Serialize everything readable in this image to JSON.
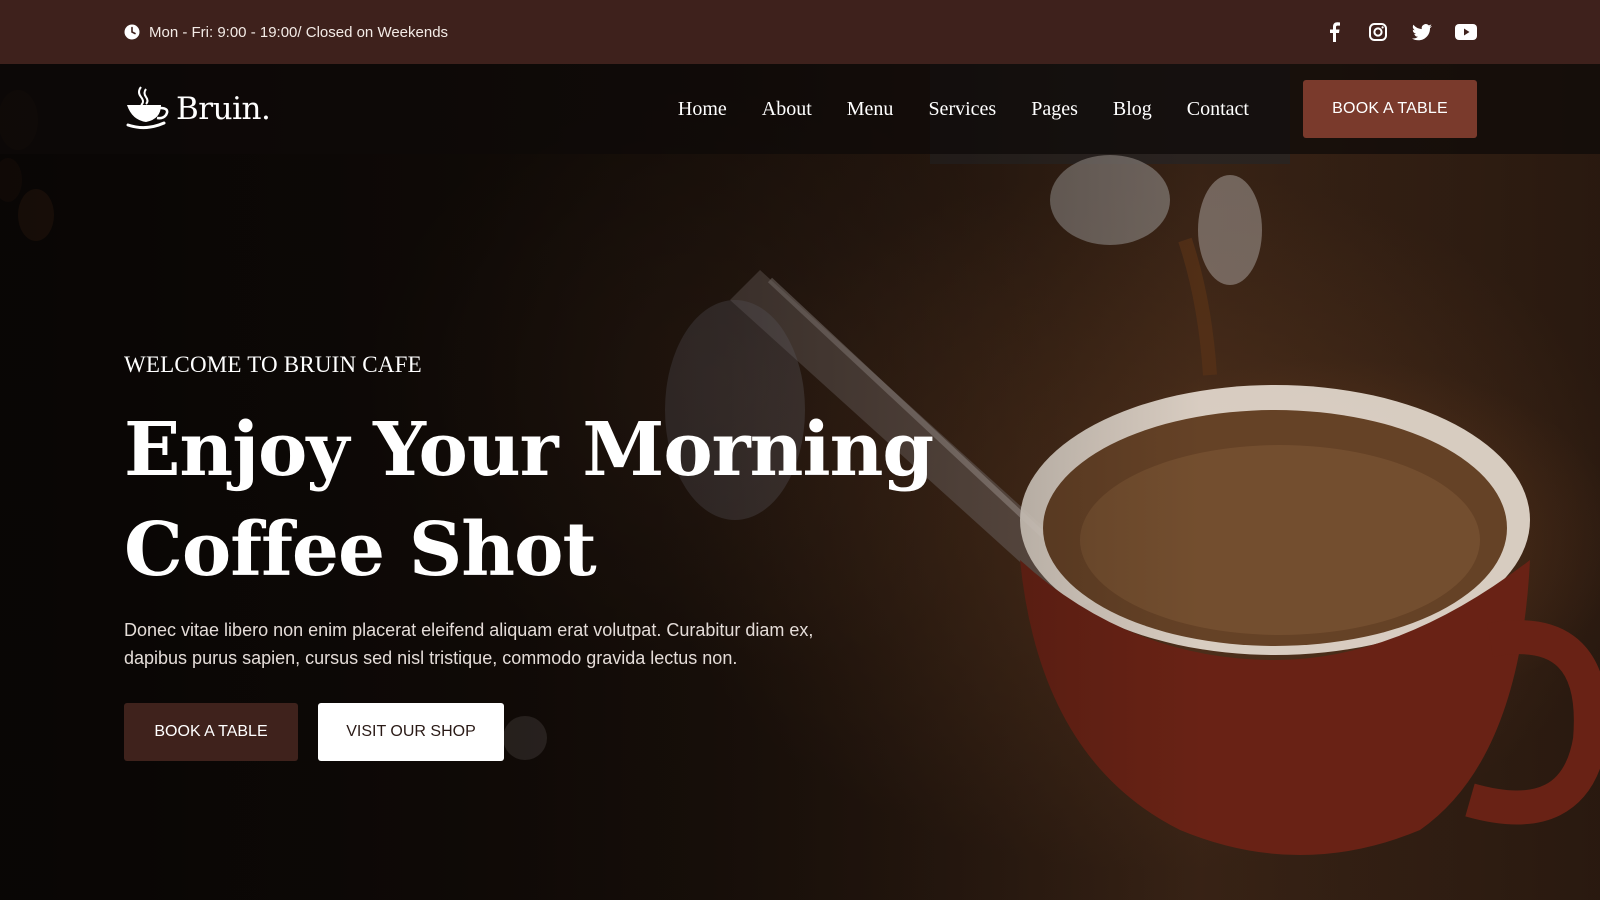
{
  "topbar": {
    "hours": "Mon - Fri: 9:00 - 19:00/ Closed on Weekends",
    "hours_icon": "clock-icon",
    "social": [
      {
        "name": "facebook-icon"
      },
      {
        "name": "instagram-icon"
      },
      {
        "name": "twitter-icon"
      },
      {
        "name": "youtube-icon"
      }
    ],
    "bg_color": "#3e211c"
  },
  "navbar": {
    "logo_text": "Bruin.",
    "logo_icon": "coffee-cup-icon",
    "links": [
      {
        "label": "Home"
      },
      {
        "label": "About"
      },
      {
        "label": "Menu"
      },
      {
        "label": "Services"
      },
      {
        "label": "Pages"
      },
      {
        "label": "Blog"
      },
      {
        "label": "Contact"
      }
    ],
    "book_label": "BOOK A TABLE",
    "accent_color": "#7a3a2c"
  },
  "hero": {
    "eyebrow": "WELCOME TO BRUIN CAFE",
    "headline_line1": "Enjoy Your Morning",
    "headline_line2": "Coffee Shot",
    "description": "Donec vitae libero non enim placerat eleifend aliquam erat volutpat. Curabitur diam ex, dapibus purus sapien, cursus sed nisl tristique, commodo gravida lectus non.",
    "primary_button": "BOOK A TABLE",
    "secondary_button": "VISIT OUR SHOP",
    "primary_color": "#3f221c"
  }
}
